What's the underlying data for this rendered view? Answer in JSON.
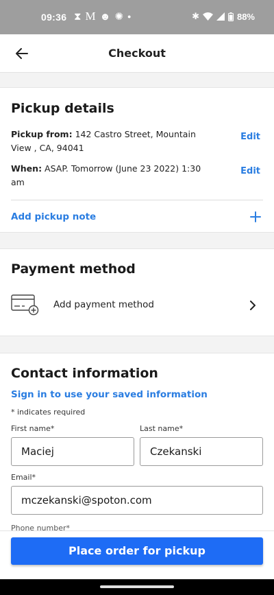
{
  "status_bar": {
    "time": "09:36",
    "battery": "88%",
    "notification_icons": [
      "hourglass-icon",
      "gmail-icon",
      "face-icon",
      "bug-icon",
      "dot-icon"
    ],
    "system_icons": [
      "bluetooth-icon",
      "wifi-icon",
      "signal-icon",
      "battery-icon"
    ]
  },
  "app_bar": {
    "title": "Checkout"
  },
  "pickup": {
    "title": "Pickup details",
    "from_label": "Pickup from:",
    "from_value": "142 Castro Street, Mountain View , CA, 94041",
    "when_label": "When:",
    "when_value": "ASAP. Tomorrow (June 23 2022) 1:30 am",
    "edit_label": "Edit",
    "add_note_label": "Add pickup note"
  },
  "payment": {
    "title": "Payment method",
    "add_label": "Add payment method"
  },
  "contact": {
    "title": "Contact information",
    "signin_label": "Sign in to use your saved information",
    "required_note": "* indicates required",
    "first_name_label": "First name*",
    "first_name_value": "Maciej",
    "last_name_label": "Last name*",
    "last_name_value": "Czekanski",
    "email_label": "Email*",
    "email_value": "mczekanski@spoton.com",
    "phone_label_cut": "Phone number*"
  },
  "cta": {
    "label": "Place order for pickup"
  },
  "colors": {
    "accent": "#2a7de1",
    "cta": "#1e6cf5",
    "status_bar": "#9e9e9e"
  }
}
